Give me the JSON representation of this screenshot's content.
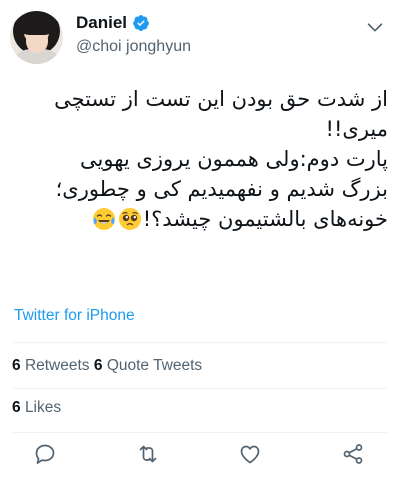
{
  "author": {
    "display_name": "Daniel",
    "handle": "@choi jonghyun",
    "verified": true
  },
  "tweet": {
    "lines": [
      "از شدت حق بودن این تست از تستچی",
      "میری!!",
      "پارت دوم:ولی هممون یروزی یهویی",
      "بزرگ شدیم و نفهمیدیم کی و چطوری؛",
      "خونه‌های بالشتیمون چیشد؟!"
    ],
    "emojis": [
      "face-with-tears-of-joy",
      "pleading-face"
    ]
  },
  "source": "Twitter for iPhone",
  "stats": {
    "retweets_count": "6",
    "retweets_label": "Retweets",
    "quotes_count": "6",
    "quotes_label": "Quote Tweets",
    "likes_count": "6",
    "likes_label": "Likes"
  },
  "colors": {
    "link": "#1d9bf0",
    "secondary_text": "#536471",
    "divider": "#eff3f4",
    "verified_badge": "#1d9bf0"
  },
  "actions": [
    "reply-icon",
    "retweet-icon",
    "like-icon",
    "share-icon"
  ]
}
